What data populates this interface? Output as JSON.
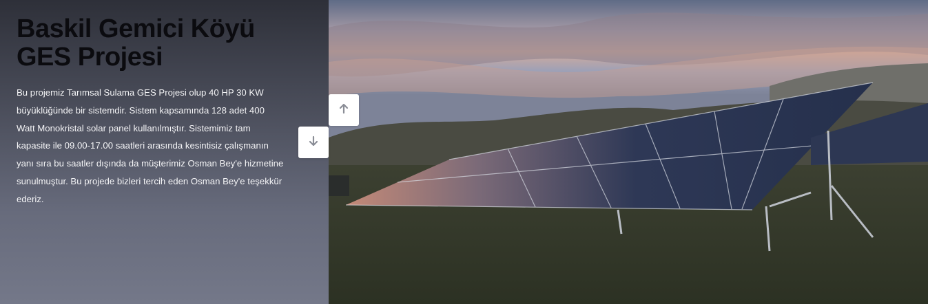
{
  "project": {
    "title": "Baskil Gemici Köyü GES Projesi",
    "description": "Bu projemiz Tarımsal Sulama GES Projesi olup 40 HP 30 KW büyüklüğünde bir sistemdir. Sistem kapsamında 128 adet 400 Watt Monokristal solar panel kullanılmıştır. Sistemimiz tam kapasite ile 09.00-17.00 saatleri arasında kesintisiz çalışmanın yanı sıra bu saatler dışında da müşterimiz Osman Bey'e hizmetine sunulmuştur. Bu projede bizleri tercih eden Osman Bey'e teşekkür ederiz."
  },
  "nav": {
    "up_icon": "arrow-up-icon",
    "down_icon": "arrow-down-icon"
  },
  "colors": {
    "panel_bg_top": "#2e3039",
    "panel_bg_bottom": "#747889",
    "title": "#0b0b0f",
    "text": "#f4f4f6",
    "button_bg": "#ffffff",
    "icon": "#8a8d96"
  }
}
